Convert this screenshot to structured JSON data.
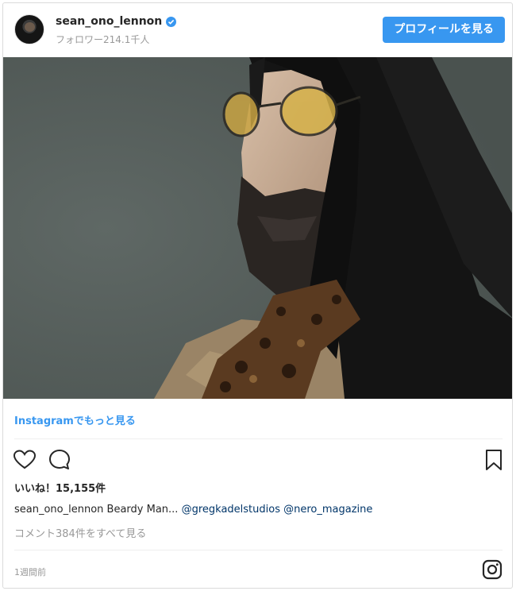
{
  "header": {
    "username": "sean_ono_lennon",
    "followers": "フォロワー214.1千人",
    "profile_button": "プロフィールを見る"
  },
  "post": {
    "view_more_link": "Instagramでもっと見る",
    "likes": "いいね！15,155件",
    "caption_user": "sean_ono_lennon",
    "caption_text": " Beardy Man... ",
    "caption_mention_1": "@gregkadelstudios",
    "caption_mention_2": "@nero_magazine",
    "comments_link": "コメント384件をすべて見る",
    "timestamp": "1週間前"
  },
  "icons": {
    "like": "heart-icon",
    "comment": "comment-icon",
    "save": "bookmark-icon",
    "instagram": "instagram-icon",
    "verified": "verified-badge-icon"
  },
  "colors": {
    "accent": "#3897f0",
    "text": "#262626",
    "muted": "#999999",
    "mention": "#003569"
  }
}
